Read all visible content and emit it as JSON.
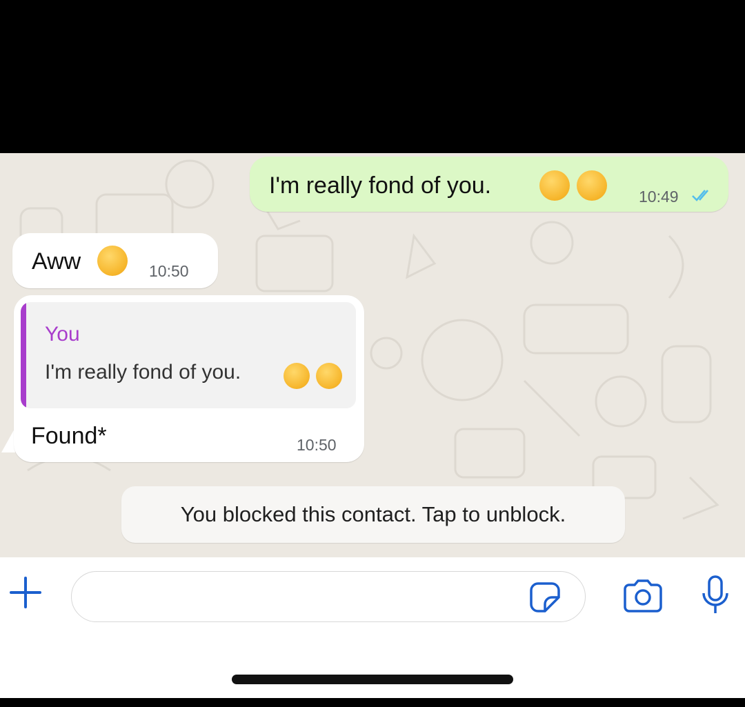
{
  "messages": [
    {
      "direction": "outgoing",
      "text": "I'm really fond of you.",
      "emojis": [
        "smiling-face-with-hearts-icon",
        "smiling-face-with-hearts-icon"
      ],
      "time": "10:49",
      "status": "read-double-check"
    },
    {
      "direction": "incoming",
      "text": "Aww",
      "emojis": [
        "relieved-face-icon"
      ],
      "time": "10:50"
    },
    {
      "direction": "incoming",
      "reply_to": {
        "author": "You",
        "text": "I'm really fond of you.",
        "emojis": [
          "smiling-face-with-hearts-icon",
          "smiling-face-with-hearts-icon"
        ]
      },
      "text": "Found*",
      "time": "10:50"
    }
  ],
  "system_notice": "You blocked this contact. Tap to unblock.",
  "composer": {
    "placeholder": "",
    "icons": [
      "plus-icon",
      "sticker-icon",
      "camera-icon",
      "microphone-icon"
    ]
  },
  "colors": {
    "outgoing_bubble": "#dcf8c6",
    "incoming_bubble": "#ffffff",
    "chat_background": "#ece8e1",
    "accent_blue": "#1b5fce",
    "quote_accent": "#a83dcc",
    "read_ticks": "#53bdeb"
  }
}
